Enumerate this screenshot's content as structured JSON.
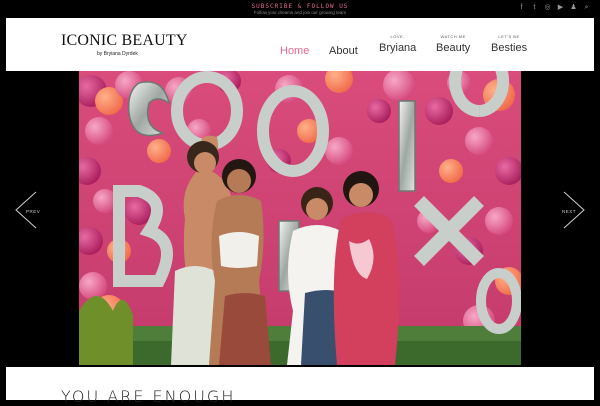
{
  "topbar": {
    "subscribe": "SUBSCRIBE & FOLLOW US",
    "tagline": "Follow your dreams and join our growing team",
    "social_icons": [
      "facebook-icon",
      "twitter-icon",
      "instagram-icon",
      "youtube-icon",
      "snapchat-icon",
      "search-icon"
    ]
  },
  "header": {
    "logo": "ICONIC BEAUTY",
    "logo_sub": "by Bryiana Dyrdek"
  },
  "nav": [
    {
      "small": "",
      "label": "Home",
      "active": true
    },
    {
      "small": "",
      "label": "About"
    },
    {
      "small": "LOVE,",
      "label": "Bryiana"
    },
    {
      "small": "WATCH ME",
      "label": "Beauty"
    },
    {
      "small": "LET'S BE",
      "label": "Besties"
    }
  ],
  "slider": {
    "prev_label": "PREV",
    "next_label": "NEXT",
    "image_description": "four friends posing in front of pink balloon wall with silver balloon letters"
  },
  "post": {
    "title": "YOU ARE ENOUGH"
  },
  "colors": {
    "accent": "#e66a8e",
    "background": "#000000",
    "header_bg": "#ffffff"
  }
}
